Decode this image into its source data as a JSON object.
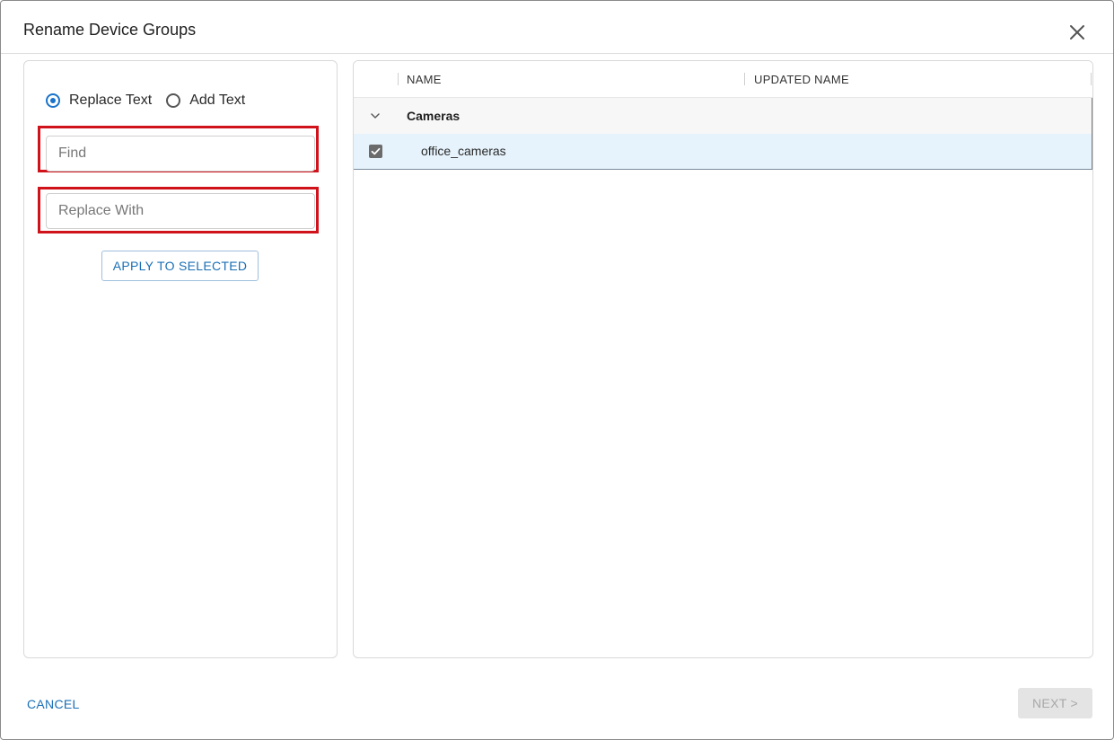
{
  "dialog": {
    "title": "Rename Device Groups"
  },
  "left_panel": {
    "mode_options": [
      {
        "label": "Replace Text",
        "selected": true
      },
      {
        "label": "Add Text",
        "selected": false
      }
    ],
    "find_input": {
      "value": "",
      "placeholder": "Find"
    },
    "replace_input": {
      "value": "",
      "placeholder": "Replace With"
    },
    "apply_button_label": "APPLY TO SELECTED"
  },
  "grid": {
    "columns": [
      "NAME",
      "UPDATED NAME"
    ],
    "groups": [
      {
        "label": "Cameras",
        "expanded": true,
        "rows": [
          {
            "name": "office_cameras",
            "updated_name": "",
            "checked": true
          }
        ]
      }
    ]
  },
  "footer": {
    "cancel_label": "CANCEL",
    "next_label": "NEXT >"
  },
  "colors": {
    "accent": "#1a73c9",
    "highlight_box": "#d0121b",
    "selected_row": "#e6f3fc"
  }
}
